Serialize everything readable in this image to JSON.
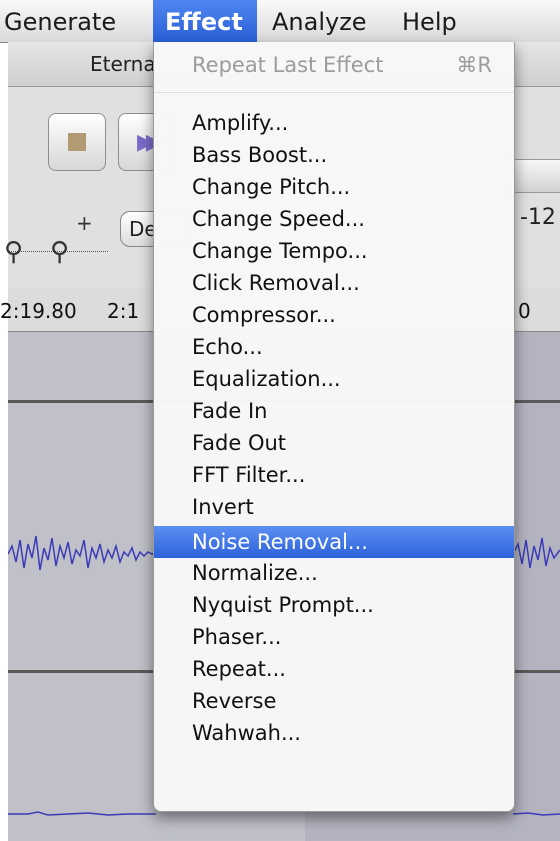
{
  "menubar": {
    "items": [
      {
        "label": "Generate"
      },
      {
        "label": "Effect"
      },
      {
        "label": "Analyze"
      },
      {
        "label": "Help"
      }
    ]
  },
  "window": {
    "title": "Eterna",
    "meter_label": "-12",
    "device_button": "De",
    "ruler_ticks": [
      "2:19.80",
      "2:1",
      "0"
    ]
  },
  "effect_menu": {
    "repeat_last": {
      "label": "Repeat Last Effect",
      "shortcut": "⌘R"
    },
    "items": [
      "Amplify...",
      "Bass Boost...",
      "Change Pitch...",
      "Change Speed...",
      "Change Tempo...",
      "Click Removal...",
      "Compressor...",
      "Echo...",
      "Equalization...",
      "Fade In",
      "Fade Out",
      "FFT Filter...",
      "Invert",
      "Noise Removal...",
      "Normalize...",
      "Nyquist Prompt...",
      "Phaser...",
      "Repeat...",
      "Reverse",
      "Wahwah..."
    ],
    "highlighted": "Noise Removal..."
  },
  "colors": {
    "menu_highlight": "#3b6fe0",
    "waveform": "#3b3bb8"
  }
}
